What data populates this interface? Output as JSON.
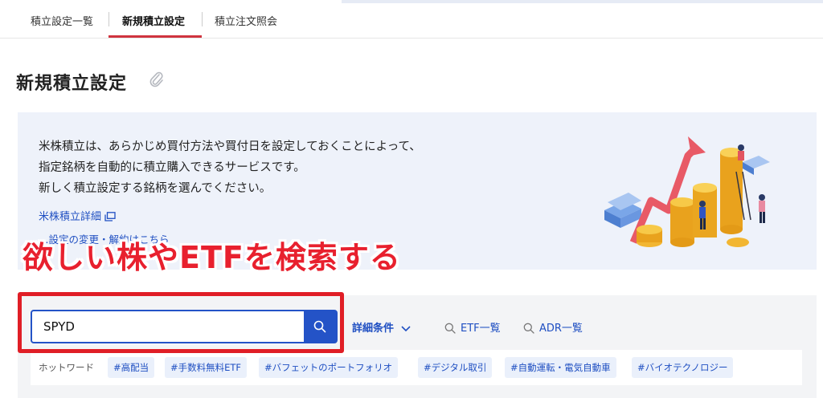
{
  "tabs": [
    {
      "label": "積立設定一覧"
    },
    {
      "label": "新規積立設定"
    },
    {
      "label": "積立注文照会"
    }
  ],
  "page": {
    "title": "新規積立設定"
  },
  "banner": {
    "lines": [
      "米株積立は、あらかじめ買付方法や買付日を設定しておくことによって、",
      "指定銘柄を自動的に積立購入できるサービスです。",
      "新しく積立設定する銘柄を選んでください。"
    ],
    "detail_link": "米株積立詳細",
    "partial_link": "…設定の変更・解約はこちら"
  },
  "caption": "欲しい株やETFを検索する",
  "search": {
    "value": "SPYD",
    "advanced_label": "詳細条件",
    "etf_list_label": "ETF一覧",
    "adr_list_label": "ADR一覧"
  },
  "hotwords": {
    "label": "ホットワード",
    "tags": [
      "#高配当",
      "#手数料無料ETF",
      "#バフェットのポートフォリオ",
      "#デジタル取引",
      "#自動運転・電気自動車",
      "#バイオテクノロジー"
    ]
  },
  "colors": {
    "accent": "#2453c7",
    "highlight": "#e01e26",
    "tab_active": "#d0343f",
    "banner_bg": "#eef2fa"
  }
}
